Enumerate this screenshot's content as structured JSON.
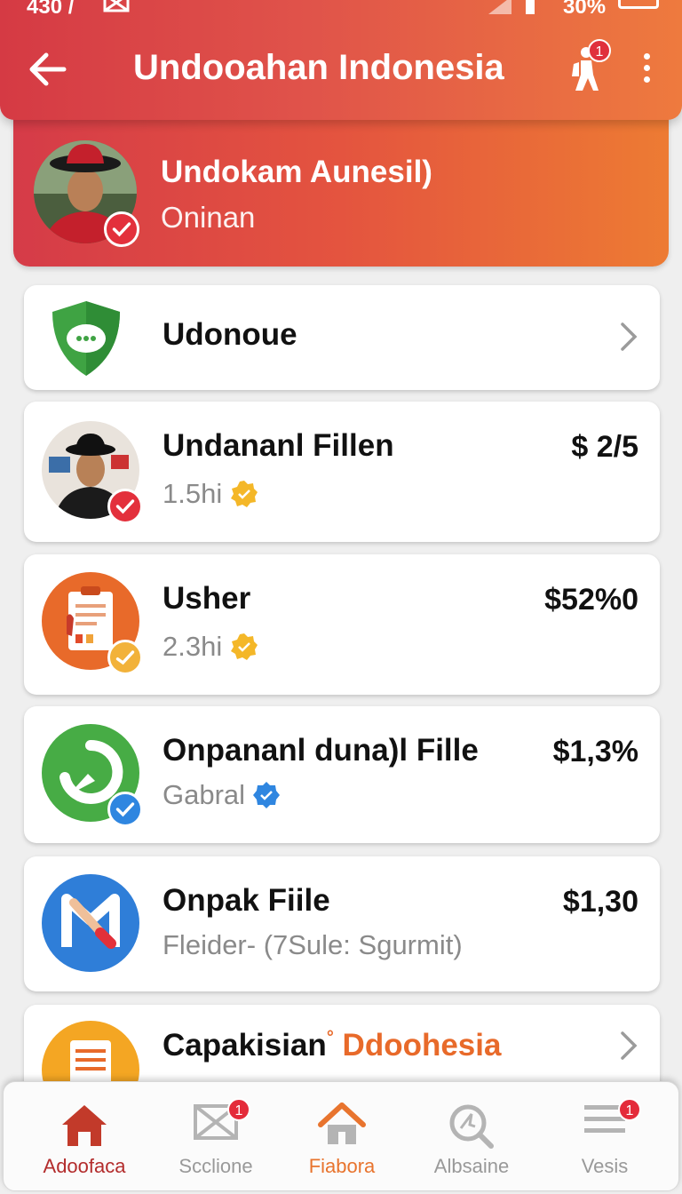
{
  "status_bar": {
    "time": "430 /",
    "battery": "30%"
  },
  "header": {
    "title": "Undooahan Indonesia",
    "notification_count": "1"
  },
  "profile": {
    "name": "Undokam Aunesil)",
    "subtitle": "Oninan"
  },
  "list": [
    {
      "title": "Udonoue",
      "subtitle": "",
      "price": "",
      "icon": "green-shield-chat-icon",
      "has_chevron": true
    },
    {
      "title": "Undananl Fillen",
      "subtitle": "1.5hi",
      "price": "$ 2/5",
      "icon": "avatar-photo",
      "has_chevron": false
    },
    {
      "title": "Usher",
      "subtitle": "2.3hi",
      "price": "$52%0",
      "icon": "clipboard-icon",
      "has_chevron": false
    },
    {
      "title": "Onpananl duna)l Fille",
      "subtitle": "Gabral",
      "price": "$1,3%",
      "icon": "green-arrow-icon",
      "has_chevron": false
    },
    {
      "title": "Onpak Fiile",
      "subtitle": "Fleider- (7Sule: Sgurmit)",
      "price": "$1,30",
      "icon": "blue-m-icon",
      "has_chevron": false
    },
    {
      "title": "Capakisian",
      "title_accent": "Ddoohesia",
      "subtitle": "",
      "price": "",
      "icon": "orange-document-icon",
      "has_chevron": true
    }
  ],
  "bottom_nav": [
    {
      "label": "Adoofaca",
      "icon": "home-icon",
      "active": true
    },
    {
      "label": "Scclione",
      "icon": "mail-icon",
      "badge": "1"
    },
    {
      "label": "Fiabora",
      "icon": "home-outline-icon"
    },
    {
      "label": "Albsaine",
      "icon": "search-icon"
    },
    {
      "label": "Vesis",
      "icon": "menu-icon",
      "badge": "1"
    }
  ],
  "colors": {
    "header_start": "#d53a44",
    "header_end": "#ee7a3e",
    "badge": "#e42b3a",
    "accent": "#e86a2a"
  }
}
